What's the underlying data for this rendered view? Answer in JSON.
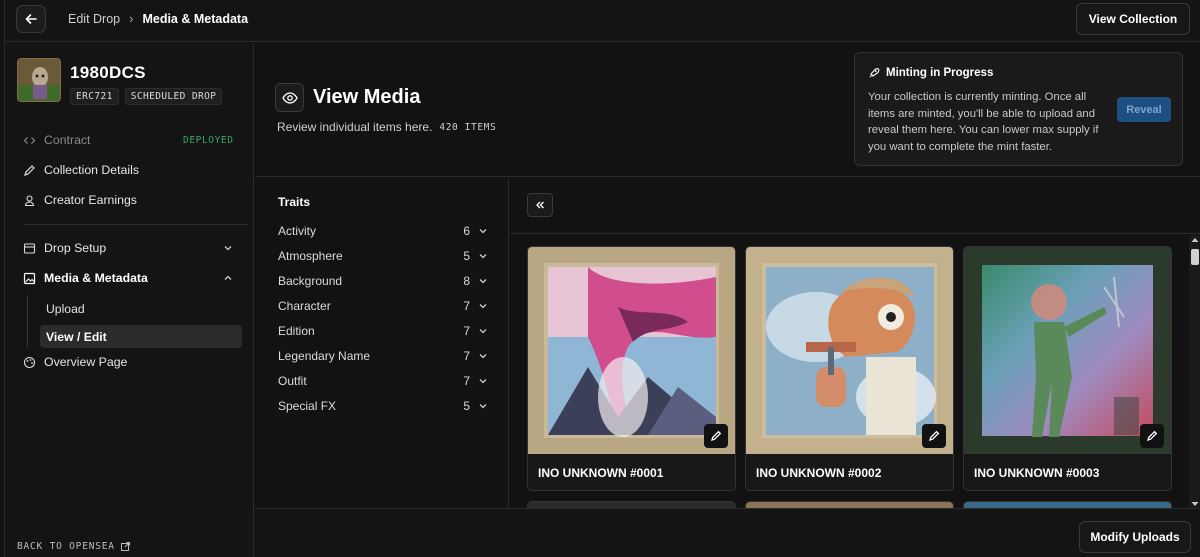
{
  "header": {
    "crumb_parent": "Edit Drop",
    "crumb_current": "Media & Metadata",
    "view_collection_label": "View Collection"
  },
  "collection": {
    "name": "1980DCS",
    "badges": [
      "ERC721",
      "SCHEDULED DROP"
    ]
  },
  "sidebar": {
    "contract_label": "Contract",
    "contract_status": "DEPLOYED",
    "collection_details_label": "Collection Details",
    "creator_earnings_label": "Creator Earnings",
    "drop_setup_label": "Drop Setup",
    "media_metadata_label": "Media & Metadata",
    "sub_items": [
      "Upload",
      "View / Edit"
    ],
    "active_sub_item": "View / Edit",
    "overview_label": "Overview Page",
    "back_label": "BACK TO OPENSEA"
  },
  "main": {
    "title": "View Media",
    "subtitle": "Review individual items here.",
    "items_count": "420 ITEMS"
  },
  "minting": {
    "title": "Minting in Progress",
    "message": "Your collection is currently minting. Once all items are minted, you'll be able to upload and reveal them here. You can lower max supply if you want to complete the mint faster.",
    "reveal_label": "Reveal"
  },
  "traits": {
    "title": "Traits",
    "items": [
      {
        "name": "Activity",
        "count": "6"
      },
      {
        "name": "Atmosphere",
        "count": "5"
      },
      {
        "name": "Background",
        "count": "8"
      },
      {
        "name": "Character",
        "count": "7"
      },
      {
        "name": "Edition",
        "count": "7"
      },
      {
        "name": "Legendary Name",
        "count": "7"
      },
      {
        "name": "Outfit",
        "count": "7"
      },
      {
        "name": "Special FX",
        "count": "5"
      }
    ]
  },
  "cards": [
    {
      "name": "INO UNKNOWN #0001"
    },
    {
      "name": "INO UNKNOWN #0002"
    },
    {
      "name": "INO UNKNOWN #0003"
    }
  ],
  "footer": {
    "modify_label": "Modify Uploads"
  },
  "colors": {
    "background": "#121212",
    "accent_blue": "#1d4f82",
    "deployed_green": "#3aa66a"
  }
}
